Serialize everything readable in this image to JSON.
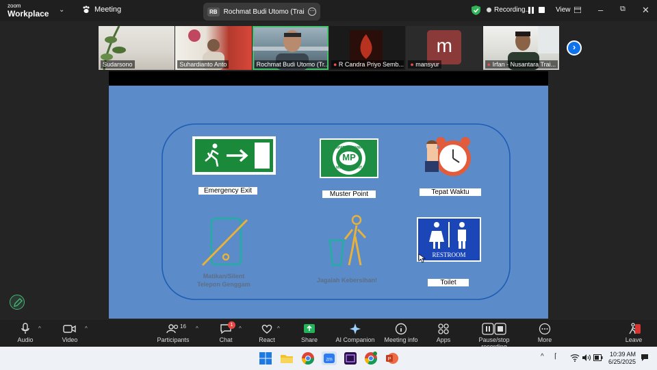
{
  "app": {
    "logo_line1": "zoom",
    "logo_line2": "Workplace",
    "meeting_tab": "Meeting",
    "speaker_initials": "RB",
    "speaker_tab": "Rochmat Budi Utomo (Trainer)'s s",
    "recording": "Recording...",
    "view": "View"
  },
  "participants": [
    {
      "name": "Sudarsono",
      "muted": false
    },
    {
      "name": "Suhardianto Anto",
      "muted": false
    },
    {
      "name": "Rochmat Budi Utomo (Tr...",
      "muted": false,
      "active": true
    },
    {
      "name": "R Candra Priyo Semb...",
      "muted": true
    },
    {
      "name": "mansyur",
      "muted": true,
      "avatar": "m"
    },
    {
      "name": "Irfan - Nusantara Trai...",
      "muted": true
    }
  ],
  "slide": {
    "emergency_exit": "Emergency Exit",
    "muster_point": "Muster Point",
    "muster_ring_top": "TEMPAT BERKUMPUL",
    "muster_ring_bottom": "MUSTER POINT",
    "muster_mp": "MP",
    "tepat_waktu": "Tepat Waktu",
    "silent_line1": "Matikan/Silent",
    "silent_line2": "Telepon Genggam",
    "jagalah": "Jagalah Kebersihan!",
    "restroom": "RESTROOM",
    "toilet": "Toilet"
  },
  "toolbar": {
    "audio": "Audio",
    "video": "Video",
    "participants": "Participants",
    "participant_count": "16",
    "chat": "Chat",
    "chat_badge": "1",
    "react": "React",
    "share": "Share",
    "ai_companion": "AI Companion",
    "meeting_info": "Meeting info",
    "apps": "Apps",
    "pause_stop": "Pause/stop recording",
    "more": "More",
    "leave": "Leave"
  },
  "taskbar": {
    "time": "10:39 AM",
    "date": "6/25/2025"
  },
  "colors": {
    "slide_bg": "#5b8bc8",
    "accent_blue": "#0e72ed",
    "active_green": "#44c36a",
    "exit_green": "#1a8a3a"
  }
}
